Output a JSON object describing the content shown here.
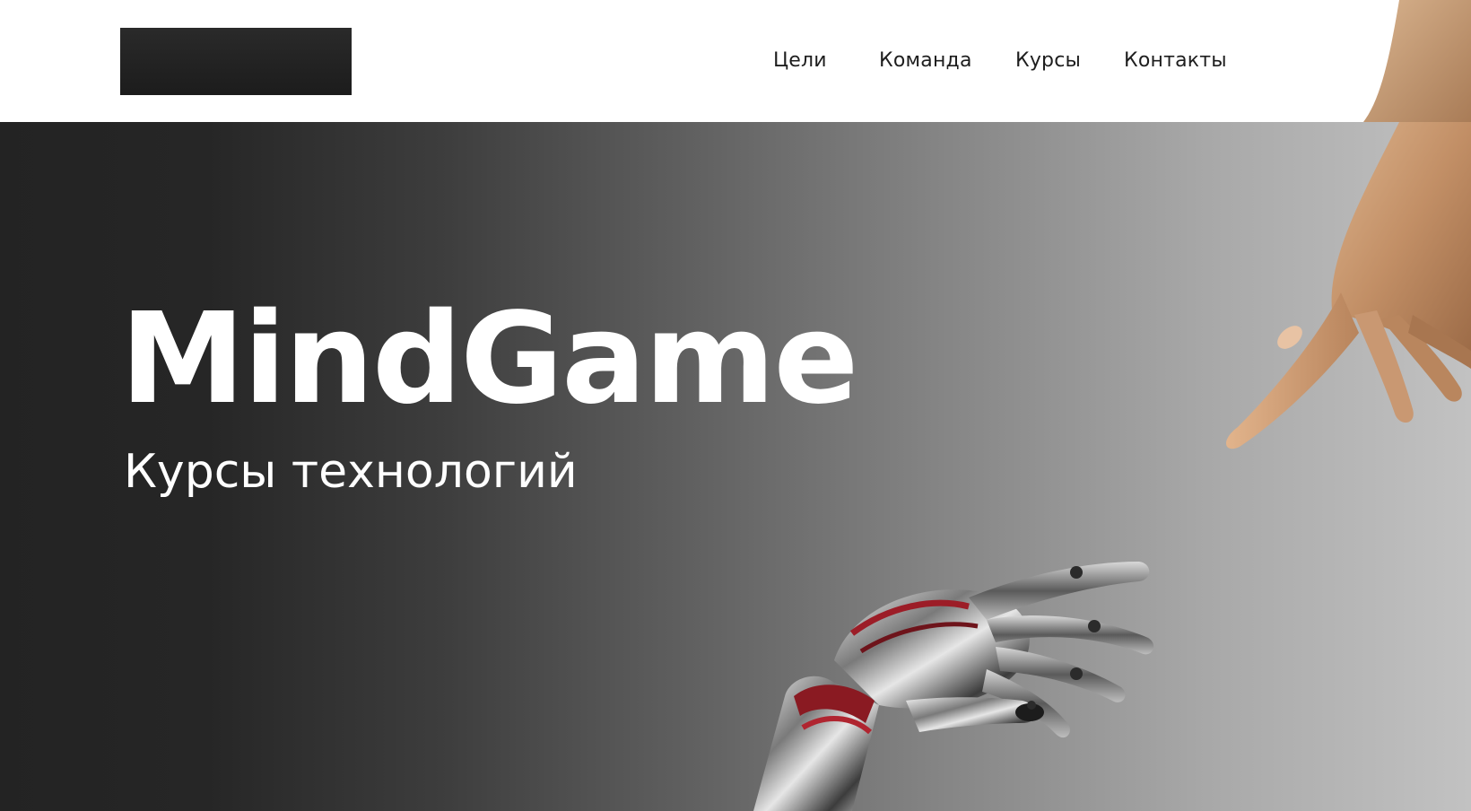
{
  "header": {
    "logo_name": "logo",
    "nav": [
      {
        "label": "Цели"
      },
      {
        "label": "Команда"
      },
      {
        "label": "Курсы"
      },
      {
        "label": "Контакты"
      }
    ]
  },
  "hero": {
    "title": "MindGame",
    "subtitle": "Курсы технологий"
  },
  "colors": {
    "header_bg": "#ffffff",
    "logo": "#1f1f1f",
    "hero_dark": "#232323",
    "hero_light": "#c2c2c2",
    "text_light": "#ffffff",
    "nav_text": "#1e1e1e"
  }
}
